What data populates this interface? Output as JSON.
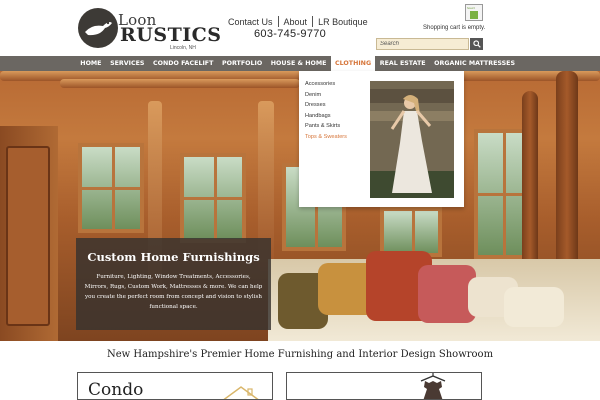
{
  "brand": {
    "name_top": "Loon",
    "name_main": "RUSTICS",
    "location": "Lincoln, NH"
  },
  "contact_nav": {
    "links": [
      "Contact Us",
      "About",
      "LR Boutique"
    ],
    "phone": "603-745-9770"
  },
  "badge": {
    "label": "houzz"
  },
  "cart": {
    "status": "Shopping cart is empty."
  },
  "search": {
    "placeholder": "Search",
    "icon": "search-icon"
  },
  "main_nav": {
    "items": [
      "HOME",
      "SERVICES",
      "CONDO FACELIFT",
      "PORTFOLIO",
      "HOUSE & HOME",
      "CLOTHING",
      "REAL ESTATE",
      "ORGANIC MATTRESSES"
    ],
    "active": "CLOTHING",
    "colors": {
      "bar": "#6b6762",
      "active_text": "#d6753a"
    }
  },
  "dropdown": {
    "items": [
      "Accessories",
      "Denim",
      "Dresses",
      "Handbags",
      "Pants & Skirts",
      "Tops & Sweaters"
    ],
    "highlighted": "Tops & Sweaters"
  },
  "hero": {
    "title": "Custom Home Furnishings",
    "text": "Furniture, Lighting, Window Treatments, Accessories, Mirrors, Rugs, Custom Work, Mattresses & more. We can help you create the perfect room from concept and vision to stylish functional space."
  },
  "tagline": "New Hampshire's Premier Home Furnishing and Interior Design Showroom",
  "cards": [
    {
      "title": "Condo"
    },
    {
      "title": ""
    }
  ]
}
